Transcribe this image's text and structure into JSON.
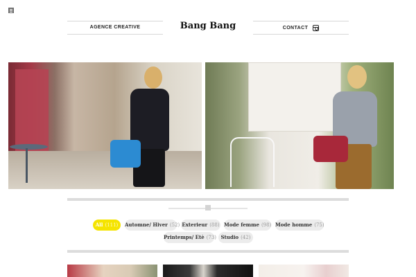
{
  "header": {
    "brand": "Bang Bang",
    "nav_left": "AGENCE CREATIVE",
    "nav_right": "CONTACT"
  },
  "icons": {
    "menu": "menu-icon",
    "social": "instagram-icon"
  },
  "hero": {
    "left_image": "model-blue-bag-street",
    "right_image": "model-red-bag-garden"
  },
  "filters": [
    {
      "label": "All",
      "count": "(111)",
      "active": true
    },
    {
      "label": "Automne/ Hiver",
      "count": "(52)",
      "active": false
    },
    {
      "label": "Exterieur",
      "count": "(88)",
      "active": false
    },
    {
      "label": "Mode femme",
      "count": "(98)",
      "active": false
    },
    {
      "label": "Mode homme",
      "count": "(75)",
      "active": false
    },
    {
      "label": "Printemps/ Etè",
      "count": "(73)",
      "active": false
    },
    {
      "label": "Studio",
      "count": "(42)",
      "active": false
    }
  ],
  "colors": {
    "accent": "#f5e400",
    "pill_bg": "#ececec"
  }
}
